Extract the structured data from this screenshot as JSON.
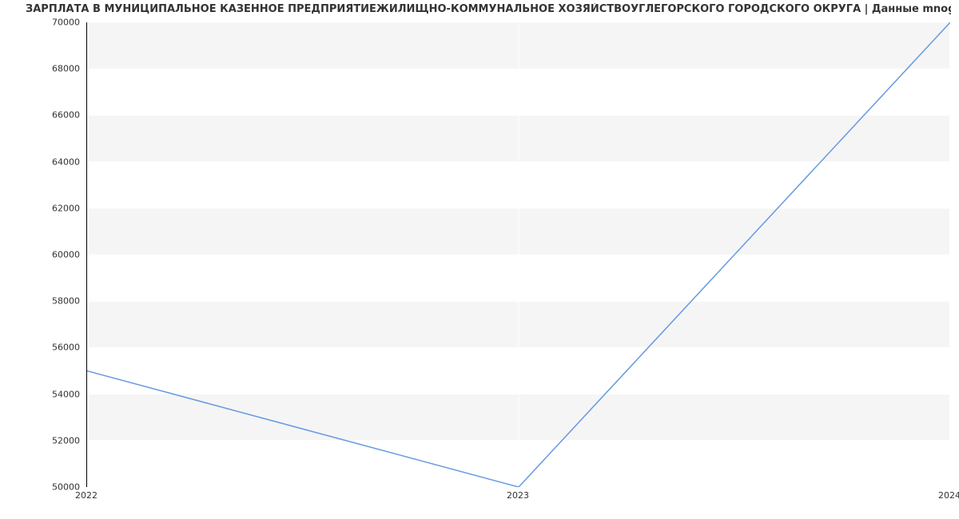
{
  "chart_data": {
    "type": "line",
    "title": "ЗАРПЛАТА В МУНИЦИПАЛЬНОЕ КАЗЕННОЕ ПРЕДПРИЯТИЕЖИЛИЩНО-КОММУНАЛЬНОЕ ХОЗЯЙСТВОУГЛЕГОРСКОГО ГОРОДСКОГО ОКРУГА | Данные mnogo.work",
    "x": [
      2022,
      2023,
      2024
    ],
    "series": [
      {
        "name": "salary",
        "values": [
          55000,
          50000,
          70000
        ],
        "color": "#6699e0"
      }
    ],
    "x_ticks": [
      2022,
      2023,
      2024
    ],
    "y_ticks": [
      50000,
      52000,
      54000,
      56000,
      58000,
      60000,
      62000,
      64000,
      66000,
      68000,
      70000
    ],
    "xlim": [
      2022,
      2024
    ],
    "ylim": [
      50000,
      70000
    ],
    "xlabel": "",
    "ylabel": ""
  }
}
